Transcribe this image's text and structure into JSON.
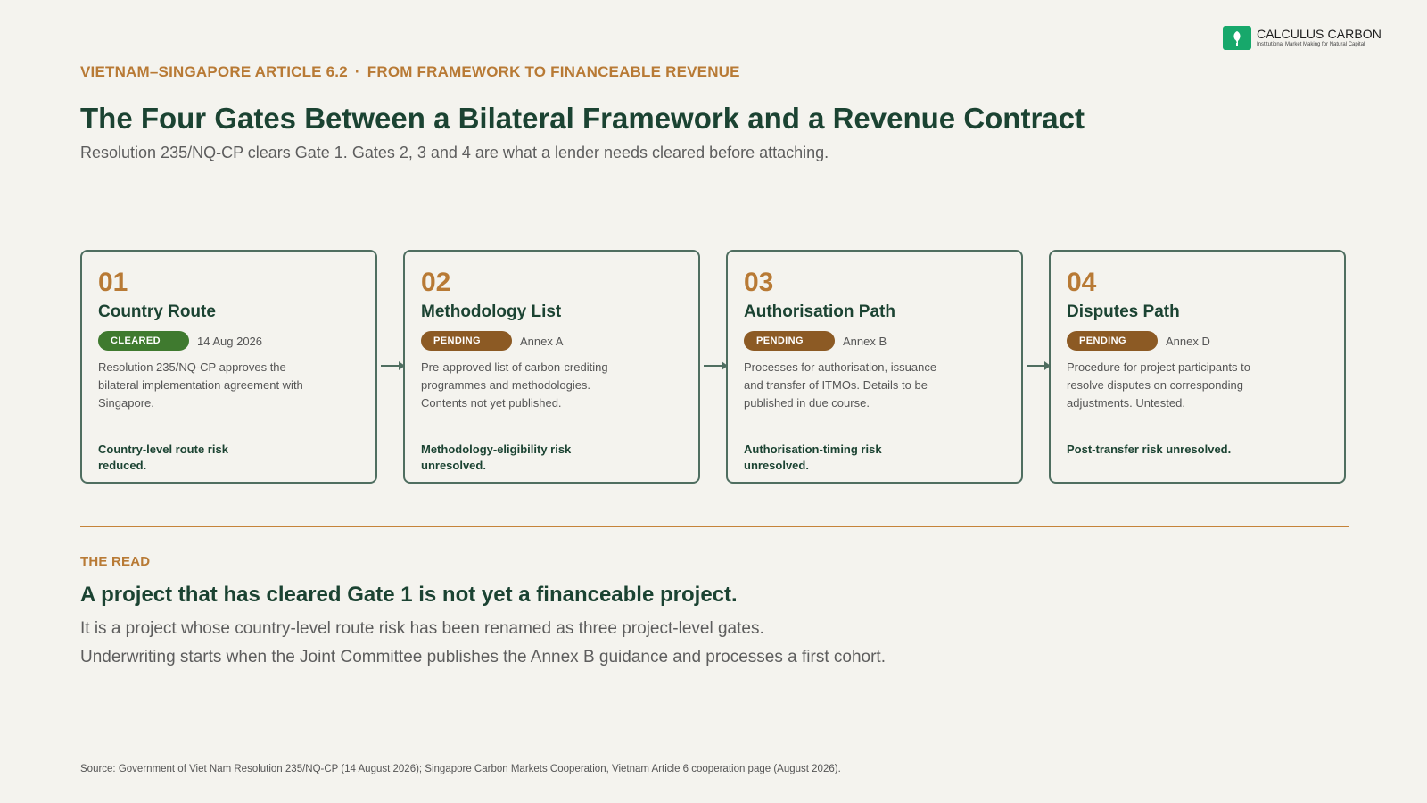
{
  "logo": {
    "name": "CALCULUS CARBON",
    "tagline": "Institutional Market Making for Natural Capital",
    "brand_color": "#17a86b"
  },
  "header": {
    "eyebrow_left": "VIETNAM–SINGAPORE ARTICLE 6.2",
    "eyebrow_separator": "·",
    "eyebrow_right": "FROM FRAMEWORK TO FINANCEABLE REVENUE",
    "title": "The Four Gates Between a Bilateral Framework and a Revenue Contract",
    "subtitle": "Resolution 235/NQ-CP clears Gate 1. Gates 2, 3 and 4 are what a lender needs cleared before attaching."
  },
  "gates": [
    {
      "number": "01",
      "name": "Country Route",
      "status": "CLEARED",
      "status_ref": "14 Aug 2026",
      "description": "Resolution 235/NQ-CP approves the bilateral implementation agreement with Singapore.",
      "risk": "Country-level route risk reduced."
    },
    {
      "number": "02",
      "name": "Methodology List",
      "status": "PENDING",
      "status_ref": "Annex A",
      "description": "Pre-approved list of carbon-crediting programmes and methodologies. Contents not yet published.",
      "risk": "Methodology-eligibility risk unresolved."
    },
    {
      "number": "03",
      "name": "Authorisation Path",
      "status": "PENDING",
      "status_ref": "Annex B",
      "description": "Processes for authorisation, issuance and transfer of ITMOs. Details to be published in due course.",
      "risk": "Authorisation-timing risk unresolved."
    },
    {
      "number": "04",
      "name": "Disputes Path",
      "status": "PENDING",
      "status_ref": "Annex D",
      "description": "Procedure for project participants to resolve disputes on corresponding adjustments. Untested.",
      "risk": "Post-transfer risk unresolved."
    }
  ],
  "read": {
    "label": "THE READ",
    "headline": "A project that has cleared Gate 1 is not yet a financeable project.",
    "line1": "It is a project whose country-level route risk has been renamed as three project-level gates.",
    "line2": "Underwriting starts when the Joint Committee publishes the Annex B guidance and processes a first cohort."
  },
  "source": "Source: Government of Viet Nam Resolution 235/NQ-CP (14 August 2026); Singapore Carbon Markets Cooperation, Vietnam Article 6 cooperation page (August 2026).",
  "colors": {
    "accent": "#b87a35",
    "heading": "#1b4332",
    "cleared": "#3f7a2f",
    "pending": "#8c5a24",
    "background": "#f4f3ee"
  }
}
